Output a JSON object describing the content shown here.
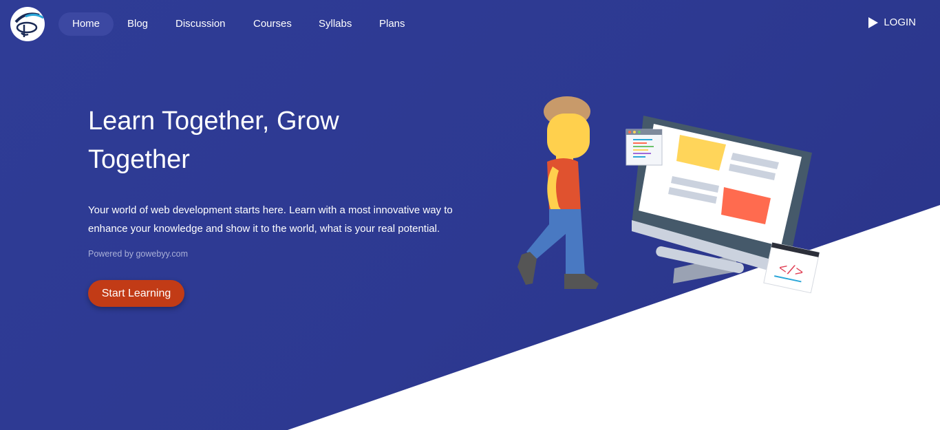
{
  "nav": {
    "items": [
      {
        "label": "Home",
        "active": true
      },
      {
        "label": "Blog",
        "active": false
      },
      {
        "label": "Discussion",
        "active": false
      },
      {
        "label": "Courses",
        "active": false
      },
      {
        "label": "Syllabs",
        "active": false
      },
      {
        "label": "Plans",
        "active": false
      }
    ],
    "login_label": "LOGIN",
    "login_icon": "play-icon",
    "logo_icon": "brand-logo"
  },
  "hero": {
    "title": "Learn Together, Grow Together",
    "description": "Your world of web development starts here. Learn with a most innovative way to enhance your knowledge and show it to the world, what is your real potential.",
    "powered_by": "Powered by gowebyy.com",
    "cta_label": "Start Learning",
    "code_tag": "</>"
  },
  "colors": {
    "background": "#2f3b94",
    "active_nav": "#3c48a2",
    "cta": "#c23b16",
    "wedge": "#ffffff"
  }
}
